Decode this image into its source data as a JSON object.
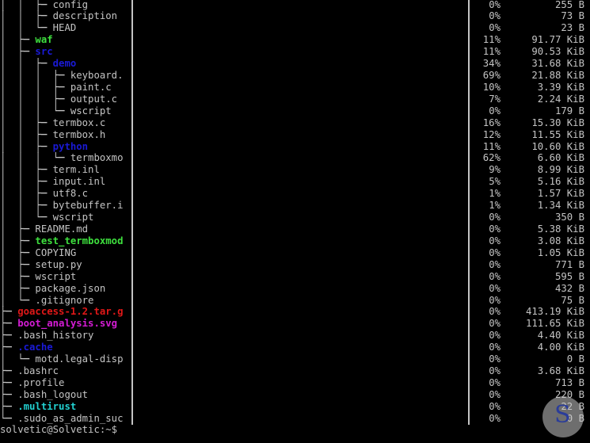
{
  "colors": {
    "default": "#c4c4c4",
    "green": "#3ee03e",
    "blue": "#1a1ad6",
    "red": "#e01818",
    "magenta": "#d41cd4",
    "cyan": "#22d0d0"
  },
  "rows": [
    {
      "prefix": "│  │  ├─ ",
      "name": "config",
      "color": "default",
      "pct": "0%",
      "size": "255 B"
    },
    {
      "prefix": "│  │  ├─ ",
      "name": "description",
      "color": "default",
      "pct": "0%",
      "size": "73 B"
    },
    {
      "prefix": "│  │  └─ ",
      "name": "HEAD",
      "color": "default",
      "pct": "0%",
      "size": "23 B"
    },
    {
      "prefix": "│  ├─ ",
      "name": "waf",
      "color": "green",
      "pct": "11%",
      "size": "91.77 KiB"
    },
    {
      "prefix": "│  ├─ ",
      "name": "src",
      "color": "blue",
      "pct": "11%",
      "size": "90.53 KiB"
    },
    {
      "prefix": "│  │  ├─ ",
      "name": "demo",
      "color": "blue",
      "pct": "34%",
      "size": "31.68 KiB"
    },
    {
      "prefix": "│  │  │  ├─ ",
      "name": "keyboard.",
      "color": "default",
      "pct": "69%",
      "size": "21.88 KiB"
    },
    {
      "prefix": "│  │  │  ├─ ",
      "name": "paint.c",
      "color": "default",
      "pct": "10%",
      "size": "3.39 KiB"
    },
    {
      "prefix": "│  │  │  ├─ ",
      "name": "output.c",
      "color": "default",
      "pct": "7%",
      "size": "2.24 KiB"
    },
    {
      "prefix": "│  │  │  └─ ",
      "name": "wscript",
      "color": "default",
      "pct": "0%",
      "size": "179 B"
    },
    {
      "prefix": "│  │  ├─ ",
      "name": "termbox.c",
      "color": "default",
      "pct": "16%",
      "size": "15.30 KiB"
    },
    {
      "prefix": "│  │  ├─ ",
      "name": "termbox.h",
      "color": "default",
      "pct": "12%",
      "size": "11.55 KiB"
    },
    {
      "prefix": "│  │  ├─ ",
      "name": "python",
      "color": "blue",
      "pct": "11%",
      "size": "10.60 KiB"
    },
    {
      "prefix": "│  │  │  └─ ",
      "name": "termboxmo",
      "color": "default",
      "pct": "62%",
      "size": "6.60 KiB"
    },
    {
      "prefix": "│  │  ├─ ",
      "name": "term.inl",
      "color": "default",
      "pct": "9%",
      "size": "8.99 KiB"
    },
    {
      "prefix": "│  │  ├─ ",
      "name": "input.inl",
      "color": "default",
      "pct": "5%",
      "size": "5.16 KiB"
    },
    {
      "prefix": "│  │  ├─ ",
      "name": "utf8.c",
      "color": "default",
      "pct": "1%",
      "size": "1.57 KiB"
    },
    {
      "prefix": "│  │  ├─ ",
      "name": "bytebuffer.i",
      "color": "default",
      "pct": "1%",
      "size": "1.34 KiB"
    },
    {
      "prefix": "│  │  └─ ",
      "name": "wscript",
      "color": "default",
      "pct": "0%",
      "size": "350 B"
    },
    {
      "prefix": "│  ├─ ",
      "name": "README.md",
      "color": "default",
      "pct": "0%",
      "size": "5.38 KiB"
    },
    {
      "prefix": "│  ├─ ",
      "name": "test_termboxmod",
      "color": "green",
      "pct": "0%",
      "size": "3.08 KiB"
    },
    {
      "prefix": "│  ├─ ",
      "name": "COPYING",
      "color": "default",
      "pct": "0%",
      "size": "1.05 KiB"
    },
    {
      "prefix": "│  ├─ ",
      "name": "setup.py",
      "color": "default",
      "pct": "0%",
      "size": "771 B"
    },
    {
      "prefix": "│  ├─ ",
      "name": "wscript",
      "color": "default",
      "pct": "0%",
      "size": "595 B"
    },
    {
      "prefix": "│  ├─ ",
      "name": "package.json",
      "color": "default",
      "pct": "0%",
      "size": "432 B"
    },
    {
      "prefix": "│  └─ ",
      "name": ".gitignore",
      "color": "default",
      "pct": "0%",
      "size": "75 B"
    },
    {
      "prefix": "├─ ",
      "name": "goaccess-1.2.tar.g",
      "color": "red",
      "pct": "0%",
      "size": "413.19 KiB"
    },
    {
      "prefix": "├─ ",
      "name": "boot_analysis.svg",
      "color": "magenta",
      "pct": "0%",
      "size": "111.65 KiB"
    },
    {
      "prefix": "├─ ",
      "name": ".bash_history",
      "color": "default",
      "pct": "0%",
      "size": "4.40 KiB"
    },
    {
      "prefix": "├─ ",
      "name": ".cache",
      "color": "blue",
      "pct": "0%",
      "size": "4.00 KiB"
    },
    {
      "prefix": "│  └─ ",
      "name": "motd.legal-disp",
      "color": "default",
      "pct": "0%",
      "size": "0 B"
    },
    {
      "prefix": "├─ ",
      "name": ".bashrc",
      "color": "default",
      "pct": "0%",
      "size": "3.68 KiB"
    },
    {
      "prefix": "├─ ",
      "name": ".profile",
      "color": "default",
      "pct": "0%",
      "size": "713 B"
    },
    {
      "prefix": "├─ ",
      "name": ".bash_logout",
      "color": "default",
      "pct": "0%",
      "size": "220 B"
    },
    {
      "prefix": "├─ ",
      "name": ".multirust",
      "color": "cyan",
      "pct": "0%",
      "size": "22 B"
    },
    {
      "prefix": "└─ ",
      "name": ".sudo_as_admin_suc",
      "color": "default",
      "pct": "0%",
      "size": "0 B"
    }
  ],
  "prompt": "solvetic@Solvetic:~$",
  "watermark": {
    "logo": "Solvetic"
  }
}
